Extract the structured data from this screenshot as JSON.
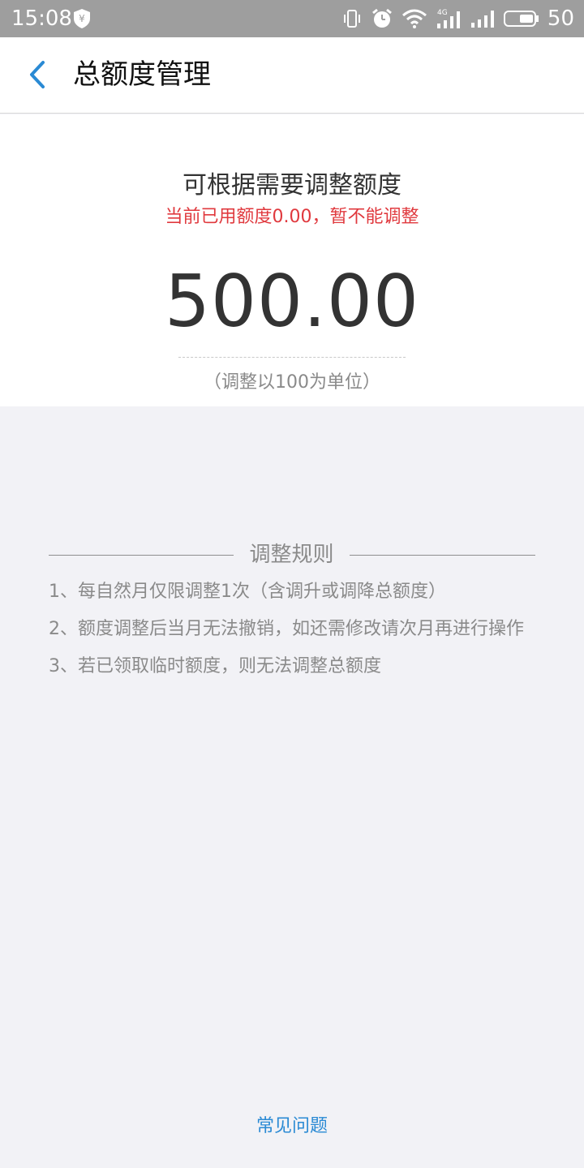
{
  "status_bar": {
    "time": "15:08",
    "battery": "50",
    "network": "4G",
    "icons": [
      "shield-yen-icon",
      "vibrate-icon",
      "alarm-icon",
      "wifi-icon",
      "signal-4g-icon",
      "signal-icon",
      "battery-icon"
    ]
  },
  "header": {
    "title": "总额度管理",
    "back_icon": "chevron-left-icon",
    "accent": "#2a8ad4"
  },
  "limit": {
    "prompt": "可根据需要调整额度",
    "warning": "当前已用额度0.00，暂不能调整",
    "amount": "500.00",
    "unit_note": "（调整以100为单位）",
    "warning_color": "#e0393e"
  },
  "rules": {
    "title": "调整规则",
    "items": [
      "1、每自然月仅限调整1次（含调升或调降总额度）",
      "2、额度调整后当月无法撤销，如还需修改请次月再进行操作",
      "3、若已领取临时额度，则无法调整总额度"
    ]
  },
  "footer": {
    "faq_link": "常见问题"
  }
}
